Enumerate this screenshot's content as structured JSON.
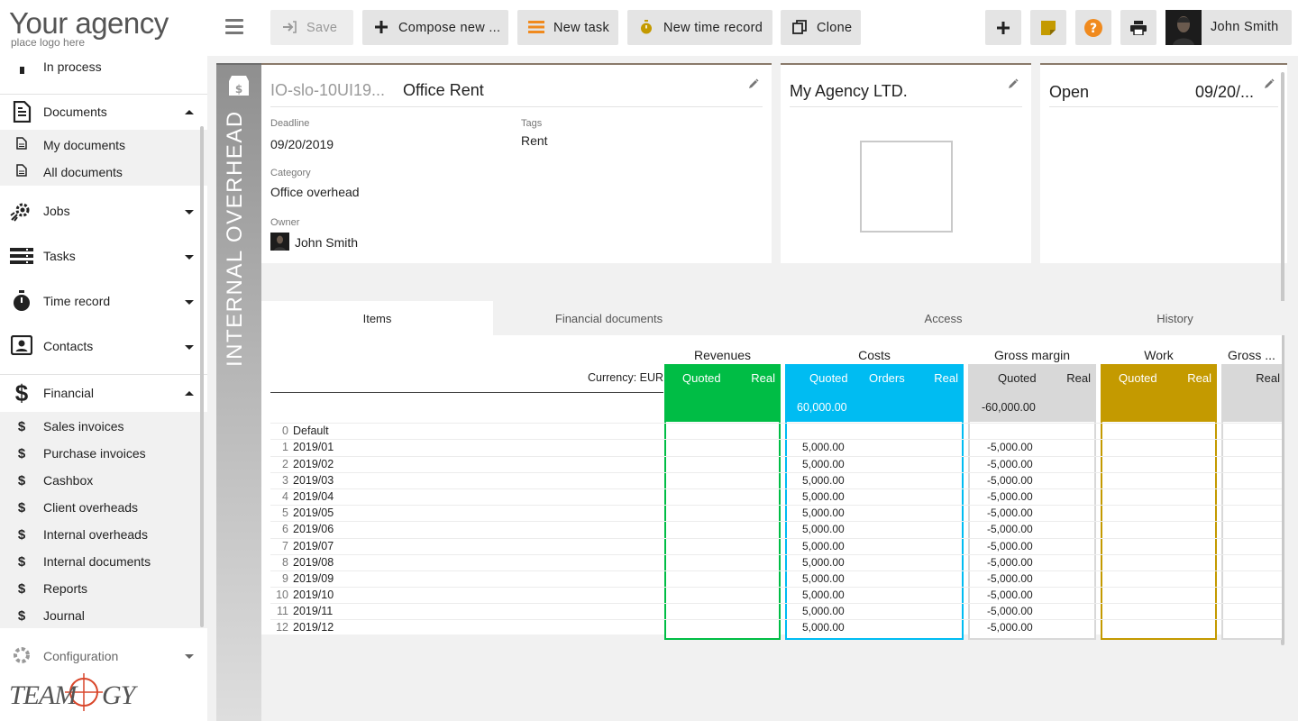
{
  "logo": {
    "main": "Your agency",
    "sub": "place logo here"
  },
  "brand_name": "TEAMOGY",
  "sidebar": {
    "in_process": "In process",
    "documents": {
      "label": "Documents",
      "items": [
        "My documents",
        "All documents"
      ]
    },
    "jobs": "Jobs",
    "tasks": "Tasks",
    "time_record": "Time record",
    "contacts": "Contacts",
    "financial": {
      "label": "Financial",
      "items": [
        "Sales invoices",
        "Purchase invoices",
        "Cashbox",
        "Client overheads",
        "Internal overheads",
        "Internal documents",
        "Reports",
        "Journal"
      ]
    },
    "configuration": "Configuration"
  },
  "toolbar": {
    "save": "Save",
    "compose": "Compose new ...",
    "new_task": "New task",
    "new_time_record": "New time record",
    "clone": "Clone",
    "user_name": "John Smith"
  },
  "record": {
    "type_label": "INTERNAL OVERHEAD",
    "code": "IO-slo-10UI19...",
    "name": "Office Rent",
    "deadline_label": "Deadline",
    "deadline": "09/20/2019",
    "tags_label": "Tags",
    "tags": "Rent",
    "category_label": "Category",
    "category": "Office overhead",
    "owner_label": "Owner",
    "owner": "John Smith",
    "company": "My Agency LTD.",
    "status": "Open",
    "status_date": "09/20/..."
  },
  "tabs": [
    "Items",
    "Financial documents",
    "Access",
    "History"
  ],
  "table": {
    "currency": "Currency: EUR",
    "groups": {
      "revenues": {
        "title": "Revenues",
        "cols": [
          "Quoted",
          "Real"
        ]
      },
      "costs": {
        "title": "Costs",
        "cols": [
          "Quoted",
          "Orders",
          "Real"
        ],
        "total": "60,000.00"
      },
      "gross_margin": {
        "title": "Gross margin",
        "cols": [
          "Quoted",
          "Real"
        ],
        "total": "-60,000.00"
      },
      "work": {
        "title": "Work",
        "cols": [
          "Quoted",
          "Real"
        ]
      },
      "gross2": {
        "title": "Gross ...",
        "cols": [
          "Real"
        ]
      }
    },
    "rows": [
      {
        "num": "0",
        "name": "Default",
        "cost": "",
        "gm": ""
      },
      {
        "num": "1",
        "name": "2019/01",
        "cost": "5,000.00",
        "gm": "-5,000.00"
      },
      {
        "num": "2",
        "name": "2019/02",
        "cost": "5,000.00",
        "gm": "-5,000.00"
      },
      {
        "num": "3",
        "name": "2019/03",
        "cost": "5,000.00",
        "gm": "-5,000.00"
      },
      {
        "num": "4",
        "name": "2019/04",
        "cost": "5,000.00",
        "gm": "-5,000.00"
      },
      {
        "num": "5",
        "name": "2019/05",
        "cost": "5,000.00",
        "gm": "-5,000.00"
      },
      {
        "num": "6",
        "name": "2019/06",
        "cost": "5,000.00",
        "gm": "-5,000.00"
      },
      {
        "num": "7",
        "name": "2019/07",
        "cost": "5,000.00",
        "gm": "-5,000.00"
      },
      {
        "num": "8",
        "name": "2019/08",
        "cost": "5,000.00",
        "gm": "-5,000.00"
      },
      {
        "num": "9",
        "name": "2019/09",
        "cost": "5,000.00",
        "gm": "-5,000.00"
      },
      {
        "num": "10",
        "name": "2019/10",
        "cost": "5,000.00",
        "gm": "-5,000.00"
      },
      {
        "num": "11",
        "name": "2019/11",
        "cost": "5,000.00",
        "gm": "-5,000.00"
      },
      {
        "num": "12",
        "name": "2019/12",
        "cost": "5,000.00",
        "gm": "-5,000.00"
      }
    ]
  },
  "colors": {
    "revenues": "#00bd45",
    "costs": "#00bcf2",
    "gross_margin": "#d8d8d8",
    "work": "#c49a00",
    "accent_orange": "#f08a1e",
    "sticky_note": "#c49a00"
  }
}
